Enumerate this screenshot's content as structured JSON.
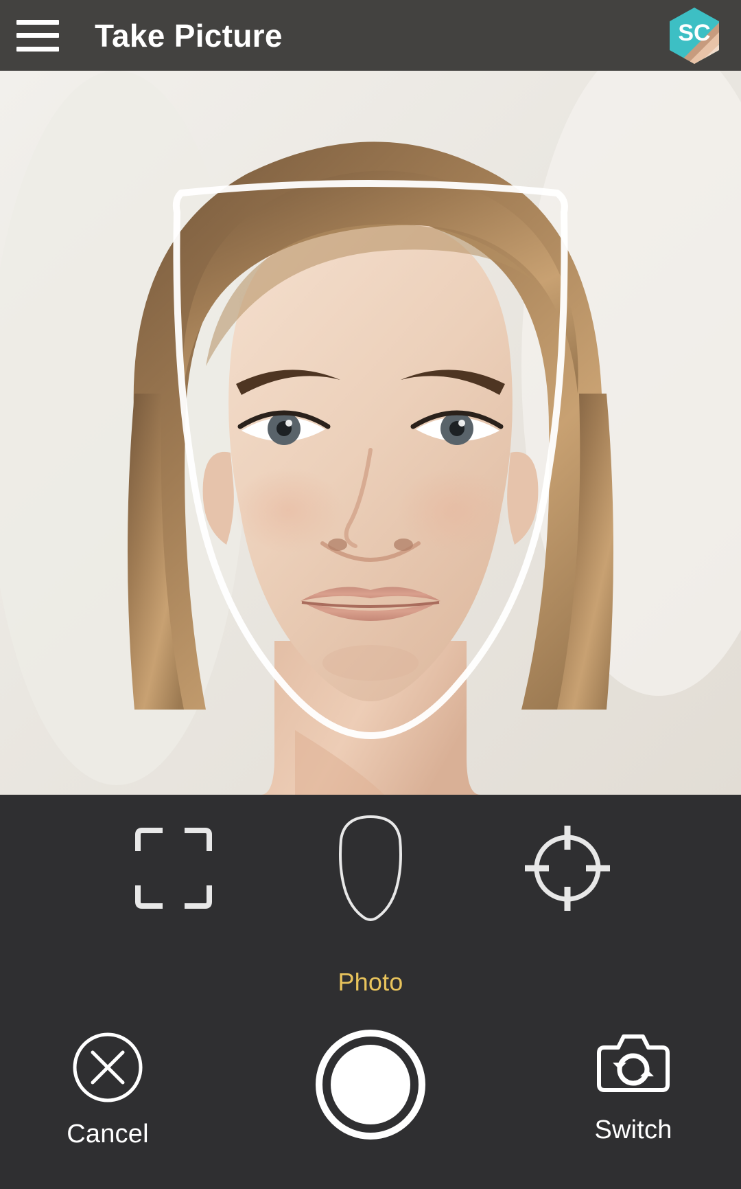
{
  "header": {
    "menu_icon": "hamburger-menu-icon",
    "title": "Take Picture",
    "logo": {
      "icon": "app-logo-hexagon-icon",
      "text": "SC",
      "bg_color": "#3dbfc4",
      "band_color": "#c79b7e"
    },
    "bg_color": "#434240"
  },
  "preview": {
    "subject": "woman-face-portrait",
    "guide_overlay_name": "face-alignment-guide",
    "guide_color": "#ffffff",
    "background_color": "#eceae6"
  },
  "controls": {
    "bg_color": "#2f2f31",
    "modes": [
      {
        "id": "crop-frame",
        "icon": "crop-frame-icon",
        "selected": false
      },
      {
        "id": "face-oval",
        "icon": "face-oval-icon",
        "selected": false
      },
      {
        "id": "crosshair-target",
        "icon": "crosshair-target-icon",
        "selected": false
      }
    ],
    "mode_label": "Photo",
    "mode_label_color": "#e9c45c",
    "actions": {
      "cancel": {
        "label": "Cancel",
        "icon": "cancel-x-circle-icon"
      },
      "shutter": {
        "label": "",
        "icon": "shutter-button-icon"
      },
      "switch": {
        "label": "Switch",
        "icon": "switch-camera-icon"
      }
    }
  }
}
